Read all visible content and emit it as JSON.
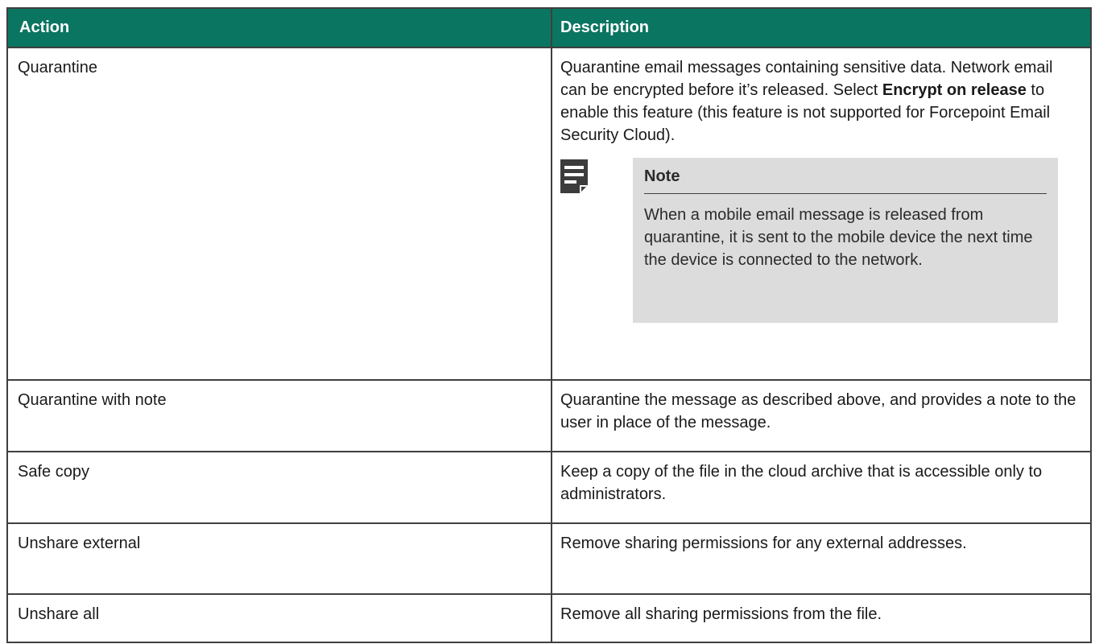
{
  "table": {
    "headers": {
      "action": "Action",
      "description": "Description"
    },
    "rows": [
      {
        "action": "Quarantine",
        "description_before": "Quarantine email messages containing sensitive data. Network email can be encrypted before it’s released. Select ",
        "description_bold": "Encrypt on release",
        "description_after": " to enable this feature (this feature is not supported for Forcepoint Email Security Cloud).",
        "note": {
          "icon": "note-icon",
          "title": "Note",
          "text": "When a mobile email message is released from quarantine, it is sent to the mobile device the next time the device is connected to the network."
        }
      },
      {
        "action": "Quarantine with note",
        "description": "Quarantine the message as described above, and provides a note to the user in place of the message."
      },
      {
        "action": "Safe copy",
        "description": "Keep a copy of the file in the cloud archive that is accessible only to administrators."
      },
      {
        "action": "Unshare external",
        "description": "Remove sharing permissions for any external addresses."
      },
      {
        "action": "Unshare all",
        "description": "Remove all sharing permissions from the file."
      }
    ]
  },
  "colors": {
    "header_bg": "#0a7561",
    "header_text": "#ffffff",
    "note_bg": "#dcdcdc",
    "border": "#3f3f3f"
  }
}
